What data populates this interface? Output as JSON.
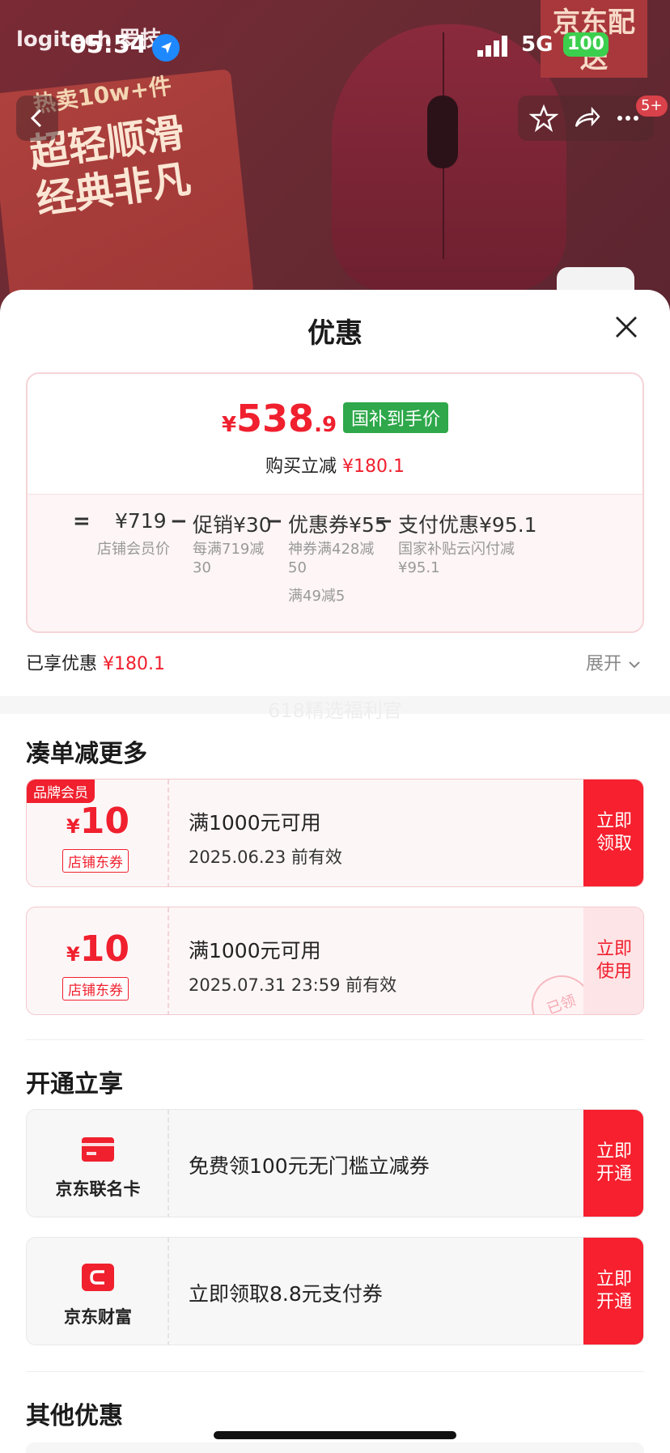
{
  "status_bar": {
    "time": "05:54",
    "network": "5G",
    "battery": "100"
  },
  "hero": {
    "brand": "logitech 罗技",
    "promo_top": "热卖10w+件",
    "promo_main": "超轻顺滑经典非凡",
    "delivery_badge": "京东配送",
    "nav_badge": "5+"
  },
  "sheet": {
    "title": "优惠",
    "price": {
      "symbol": "¥",
      "integer": "538",
      "decimal": ".9"
    },
    "price_tag": "国补到手价",
    "save_label": "购买立减",
    "save_amount": "¥180.1",
    "breakdown": {
      "eq": "=",
      "minus": "−",
      "member_price": "¥719",
      "member_label": "店铺会员价",
      "promo_title": "促销¥30",
      "promo_sub": "每满719减30",
      "coupon_title": "优惠券¥55",
      "coupon_sub1": "神券满428减50",
      "coupon_sub2": "满49减5",
      "pay_title": "支付优惠¥95.1",
      "pay_sub": "国家补贴云闪付减¥95.1"
    },
    "enjoyed_label": "已享优惠",
    "enjoyed_amount": "¥180.1",
    "expand_label": "展开",
    "gap_label": "618精选福利官"
  },
  "sections": {
    "more": "凑单减更多",
    "open": "开通立享",
    "other": "其他优惠"
  },
  "coupons": [
    {
      "ribbon": "品牌会员",
      "symbol": "¥",
      "amount": "10",
      "type": "店铺东券",
      "condition": "满1000元可用",
      "validity": "2025.06.23 前有效",
      "cta": "立即领取"
    },
    {
      "symbol": "¥",
      "amount": "10",
      "type": "店铺东券",
      "condition": "满1000元可用",
      "validity": "2025.07.31 23:59 前有效",
      "cta": "立即使用",
      "stamp": "已领"
    }
  ],
  "services": [
    {
      "name": "京东联名卡",
      "desc": "免费领100元无门槛立减券",
      "cta": "立即开通"
    },
    {
      "name": "京东财富",
      "desc": "立即领取8.8元支付券",
      "cta": "立即开通"
    }
  ],
  "colors": {
    "accent": "#f0202e",
    "green_tag": "#2ea84a"
  }
}
